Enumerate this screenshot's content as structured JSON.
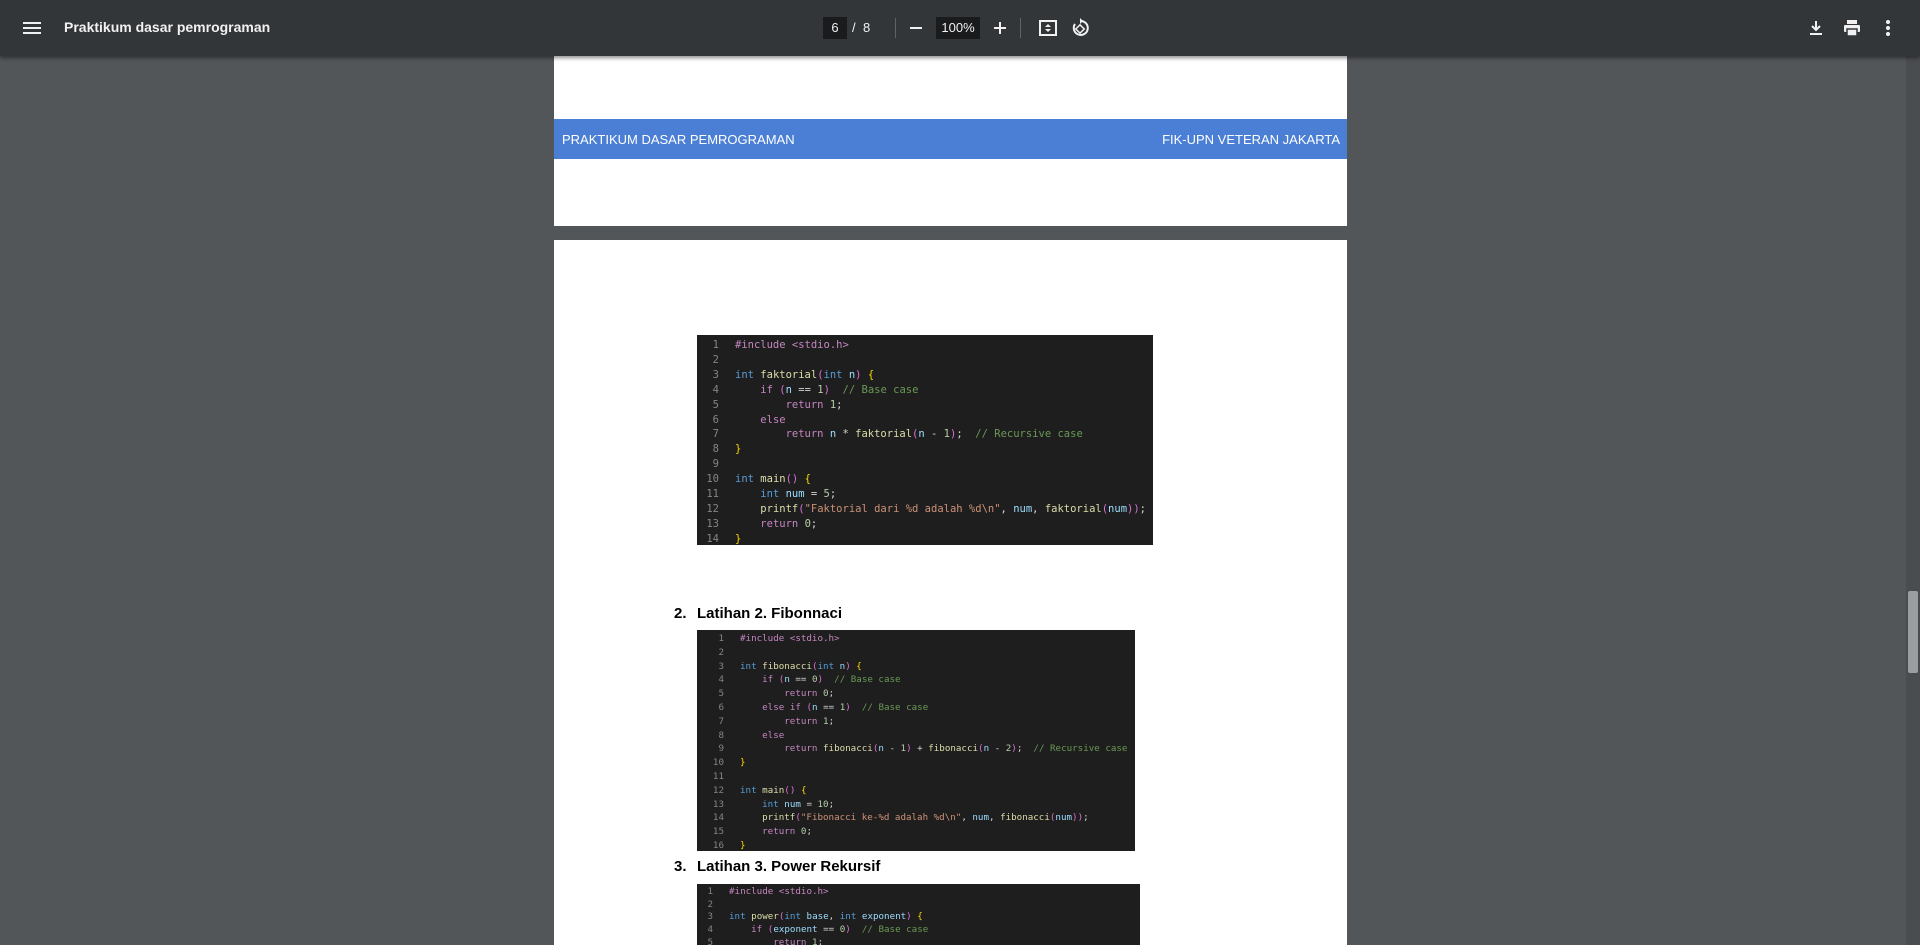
{
  "toolbar": {
    "title": "Praktikum dasar pemrograman",
    "current_page": "6",
    "separator": "/",
    "total_pages": "8",
    "zoom": "100%",
    "icons": [
      "menu-icon",
      "zoom-out-icon",
      "zoom-in-icon",
      "fit-page-icon",
      "rotate-icon",
      "download-icon",
      "print-icon",
      "more-vert-icon"
    ]
  },
  "footer": {
    "left": "PRAKTIKUM DASAR PEMROGRAMAN",
    "right": "FIK-UPN VETERAN JAKARTA"
  },
  "sections": [
    {
      "number": "2.",
      "title": "Latihan 2. Fibonnaci"
    },
    {
      "number": "3.",
      "title": "Latihan 3. Power Rekursif"
    }
  ],
  "code_blocks": [
    {
      "id": "faktorial",
      "lines": [
        "#include <stdio.h>",
        "",
        "int faktorial(int n) {",
        "    if (n == 1)  // Base case",
        "        return 1;",
        "    else",
        "        return n * faktorial(n - 1);  // Recursive case",
        "}",
        "",
        "int main() {",
        "    int num = 5;",
        "    printf(\"Faktorial dari %d adalah %d\\n\", num, faktorial(num));",
        "    return 0;",
        "}"
      ]
    },
    {
      "id": "fibonacci",
      "lines": [
        "#include <stdio.h>",
        "",
        "int fibonacci(int n) {",
        "    if (n == 0)  // Base case",
        "        return 0;",
        "    else if (n == 1)  // Base case",
        "        return 1;",
        "    else",
        "        return fibonacci(n - 1) + fibonacci(n - 2);  // Recursive case",
        "}",
        "",
        "int main() {",
        "    int num = 10;",
        "    printf(\"Fibonacci ke-%d adalah %d\\n\", num, fibonacci(num));",
        "    return 0;",
        "}"
      ]
    },
    {
      "id": "power",
      "lines": [
        "#include <stdio.h>",
        "",
        "int power(int base, int exponent) {",
        "    if (exponent == 0)  // Base case",
        "        return 1;"
      ]
    }
  ],
  "syntax_colors": {
    "keyword": "#569cd6",
    "control": "#c586c0",
    "function": "#dcdcaa",
    "string": "#ce9178",
    "number": "#b5cea8",
    "comment": "#6a9955",
    "variable": "#9cdcfe",
    "brace": "#ffd700",
    "paren": "#da70d6",
    "text": "#d4d4d4"
  }
}
